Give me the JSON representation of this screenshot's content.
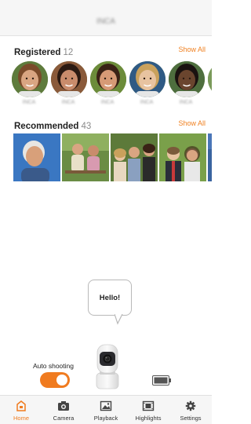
{
  "header": {
    "title": "INCA"
  },
  "registered": {
    "label": "Registered",
    "count": "12",
    "show_all": "Show All",
    "people": [
      {
        "name": "INCA",
        "skin": "#d9a582",
        "hair": "#7a4a2a",
        "bg": "#5e7b3c"
      },
      {
        "name": "INCA",
        "skin": "#c98c6c",
        "hair": "#2b1a12",
        "bg": "#8a5a3a"
      },
      {
        "name": "INCA",
        "skin": "#d69a76",
        "hair": "#3a2216",
        "bg": "#6c8c3a"
      },
      {
        "name": "INCA",
        "skin": "#e8c3a0",
        "hair": "#c9a15c",
        "bg": "#2f5a84"
      },
      {
        "name": "INCA",
        "skin": "#6a452e",
        "hair": "#1a1210",
        "bg": "#4e6e3e"
      },
      {
        "name": "INCA",
        "skin": "#d9a582",
        "hair": "#6a4a2a",
        "bg": "#7a9a5a"
      }
    ]
  },
  "recommended": {
    "label": "Recommended",
    "count": "43",
    "show_all": "Show All",
    "photos": [
      {
        "name": "elderly-man-photo",
        "bg": "#3a77c2"
      },
      {
        "name": "two-people-bench-photo",
        "bg": "#6a8c44"
      },
      {
        "name": "family-photo",
        "bg": "#5d7a3a"
      },
      {
        "name": "couple-photo",
        "bg": "#7aa04a"
      },
      {
        "name": "partial-photo",
        "bg": "#4a76b8"
      }
    ]
  },
  "assistant": {
    "bubble": "Hello!"
  },
  "controls": {
    "auto_shooting_label": "Auto shooting",
    "auto_shooting_on": true
  },
  "colors": {
    "accent": "#f07b1f"
  },
  "tabs": [
    {
      "label": "Home",
      "icon": "home-icon",
      "active": true
    },
    {
      "label": "Camera",
      "icon": "camera-icon",
      "active": false
    },
    {
      "label": "Playback",
      "icon": "playback-icon",
      "active": false
    },
    {
      "label": "Highlights",
      "icon": "highlights-icon",
      "active": false
    },
    {
      "label": "Settings",
      "icon": "gear-icon",
      "active": false
    }
  ]
}
